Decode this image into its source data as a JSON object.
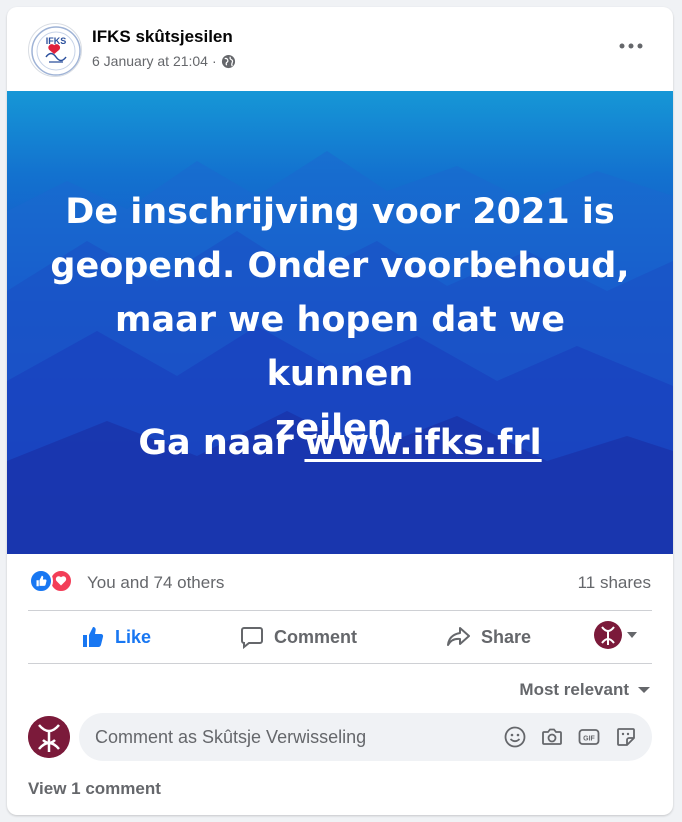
{
  "post": {
    "page_name": "IFKS skûtsjesilen",
    "timestamp": "6 January at 21:04",
    "separator": "·",
    "audience_icon": "globe-icon",
    "more_icon": "more-options-icon",
    "avatar_text": "IFKS"
  },
  "image": {
    "lines": [
      "De inschrijving voor 2021 is",
      "geopend. Onder voorbehoud,",
      "maar we hopen dat we kunnen",
      "zeilen."
    ],
    "link_prefix": "Ga naar ",
    "link_text": "www.ifks.frl",
    "colors": {
      "top": "#1697d6",
      "bottom": "#1a2a9c"
    }
  },
  "reactions": {
    "icons": [
      "like-reaction-icon",
      "love-reaction-icon"
    ],
    "summary": "You and 74 others",
    "shares": "11 shares"
  },
  "actions": {
    "like": "Like",
    "comment": "Comment",
    "share": "Share",
    "like_color": "#1877f2"
  },
  "comments": {
    "sort_label": "Most relevant",
    "placeholder": "Comment as Skûtsje Verwisseling",
    "tools": [
      "emoji-icon",
      "camera-icon",
      "gif-icon",
      "sticker-icon"
    ],
    "view_label": "View 1 comment"
  }
}
